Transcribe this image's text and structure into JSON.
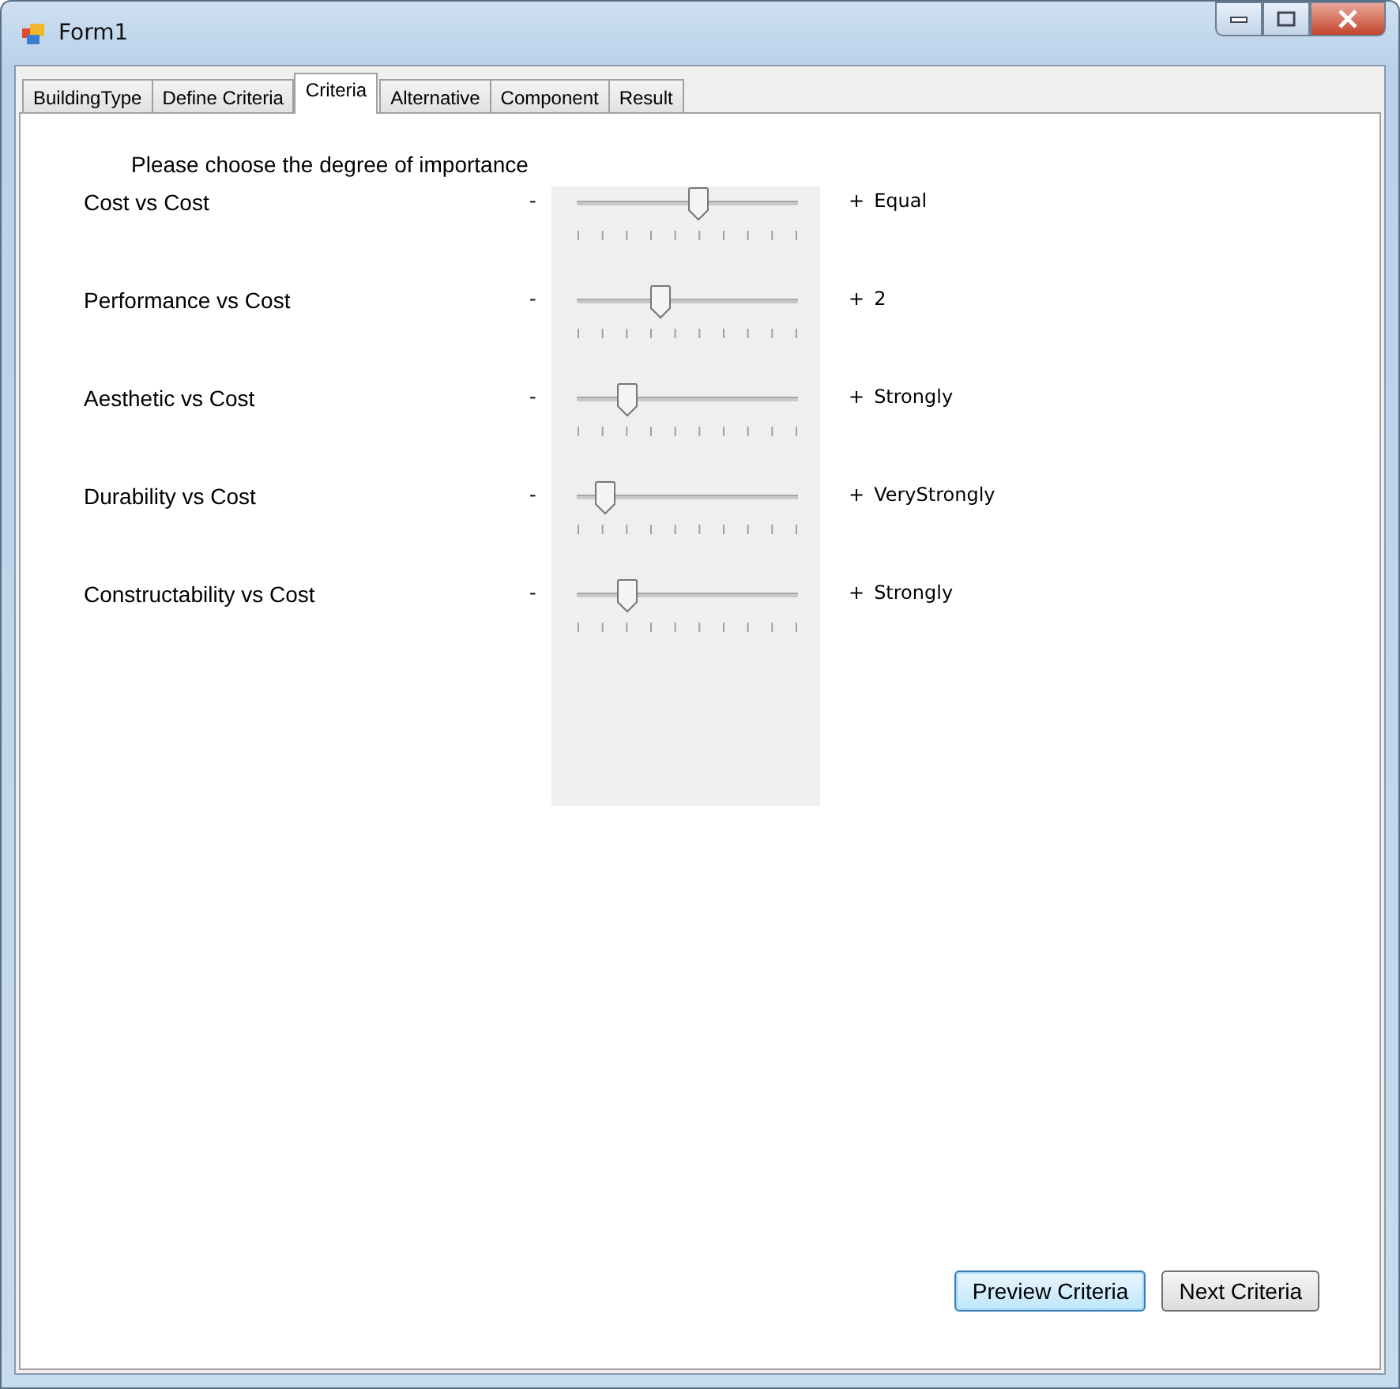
{
  "window": {
    "title": "Form1"
  },
  "tabs": [
    {
      "label": "BuildingType",
      "selected": false
    },
    {
      "label": "Define Criteria",
      "selected": false
    },
    {
      "label": "Criteria",
      "selected": true
    },
    {
      "label": "Alternative",
      "selected": false
    },
    {
      "label": "Component",
      "selected": false
    },
    {
      "label": "Result",
      "selected": false
    }
  ],
  "instruction": "Please choose the degree of importance",
  "comparisons": [
    {
      "name": "Cost vs Cost",
      "minus": "-",
      "plus": "+",
      "level": 0.55,
      "reading": "Equal"
    },
    {
      "name": "Performance vs Cost",
      "minus": "-",
      "plus": "+",
      "level": 0.38,
      "reading": "2"
    },
    {
      "name": "Aesthetic vs Cost",
      "minus": "-",
      "plus": "+",
      "level": 0.23,
      "reading": "Strongly"
    },
    {
      "name": "Durability vs Cost",
      "minus": "-",
      "plus": "+",
      "level": 0.13,
      "reading": "VeryStrongly"
    },
    {
      "name": "Constructability vs Cost",
      "minus": "-",
      "plus": "+",
      "level": 0.23,
      "reading": "Strongly"
    }
  ],
  "buttons": [
    {
      "label": "Preview Criteria",
      "focused": true
    },
    {
      "label": "Next Criteria",
      "focused": false
    }
  ]
}
